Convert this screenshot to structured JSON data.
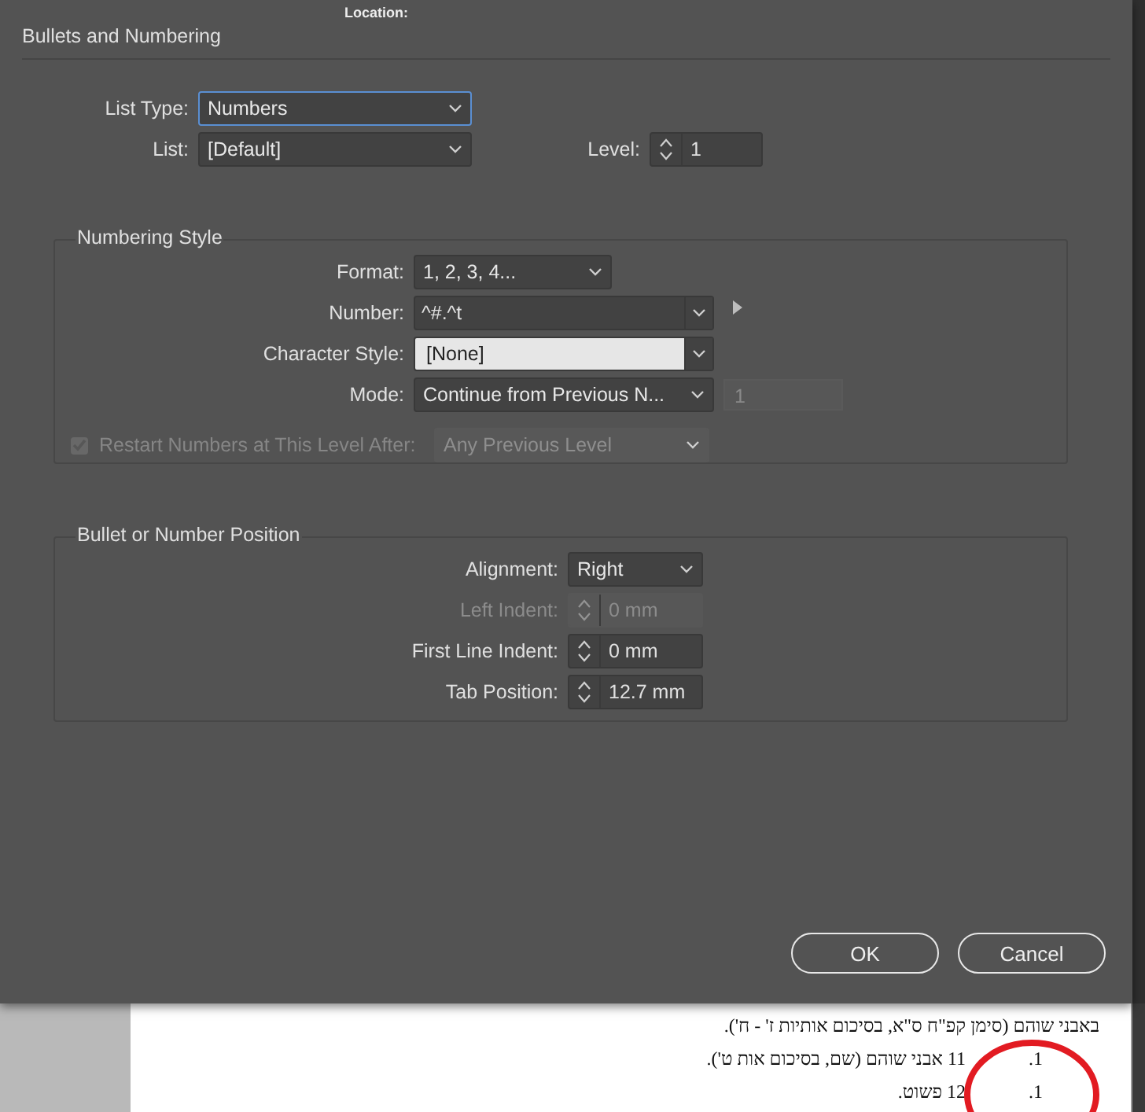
{
  "app": {
    "location_label": "Location:"
  },
  "dialog": {
    "title": "Bullets and Numbering",
    "list_type": {
      "label": "List Type:",
      "value": "Numbers",
      "focused": true
    },
    "list": {
      "label": "List:",
      "value": "[Default]"
    },
    "level": {
      "label": "Level:",
      "value": "1"
    },
    "numbering_style": {
      "title": "Numbering Style",
      "format": {
        "label": "Format:",
        "value": "1, 2, 3, 4..."
      },
      "number": {
        "label": "Number:",
        "value": "^#.^t"
      },
      "character_style": {
        "label": "Character Style:",
        "value": "[None]"
      },
      "mode": {
        "label": "Mode:",
        "value": "Continue from Previous N...",
        "start_at": "1"
      },
      "restart": {
        "label": "Restart Numbers at This Level After:",
        "checked": true,
        "disabled": true,
        "value": "Any Previous Level"
      }
    },
    "position": {
      "title": "Bullet or Number Position",
      "fields": [
        {
          "kind": "select",
          "label": "Alignment:",
          "value": "Right",
          "disabled": false
        },
        {
          "kind": "spinner",
          "label": "Left Indent:",
          "value": "0 mm",
          "disabled": true
        },
        {
          "kind": "spinner",
          "label": "First Line Indent:",
          "value": "0 mm",
          "disabled": false
        },
        {
          "kind": "spinner",
          "label": "Tab Position:",
          "value": "12.7 mm",
          "disabled": false
        }
      ]
    },
    "buttons": [
      "OK",
      "Cancel"
    ]
  },
  "document": {
    "lines": [
      {
        "text": "באבני שוהם (סימן קפ\"ח ס\"א, בסיכום אותיות ז' - ח')."
      },
      {
        "text": "אבני שוהם (שם, בסיכום אות ט').",
        "number": "11",
        "marker": ".1"
      },
      {
        "text": "פשוט.",
        "number": "12",
        "marker": ".1"
      }
    ]
  }
}
